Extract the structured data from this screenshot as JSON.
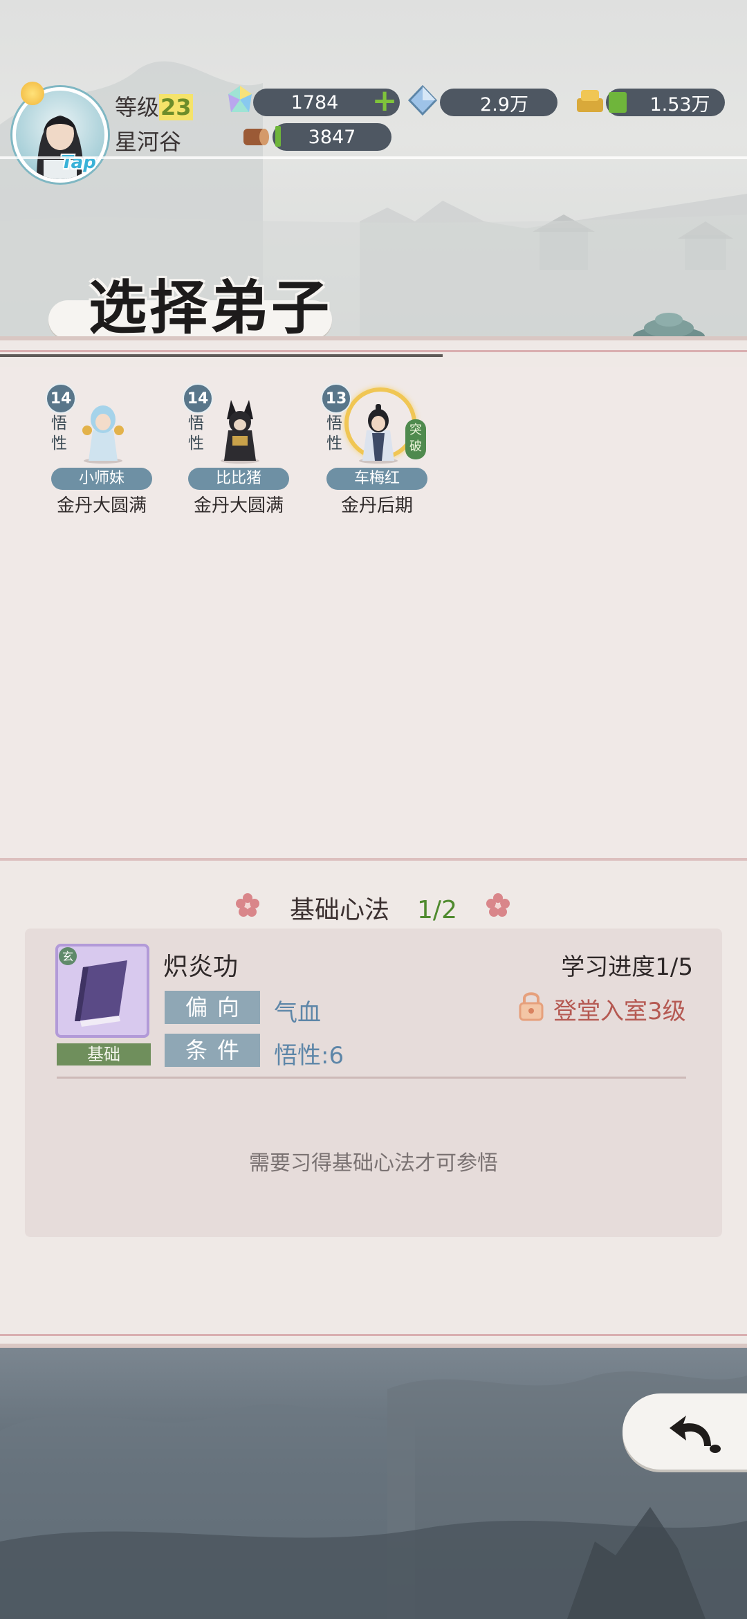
{
  "header": {
    "level_label": "等级",
    "level_value": "23",
    "sect_name": "星河谷",
    "avatar_badge": "Tap",
    "resources": {
      "spirit_stone": "1784",
      "crystal": "2.9万",
      "gold": "1.53万",
      "wood": "3847"
    },
    "add_symbol": "+"
  },
  "title": "选择弟子",
  "disciples": [
    {
      "level": "14",
      "attr": "悟性",
      "name": "小师妹",
      "realm": "金丹大圆满"
    },
    {
      "level": "14",
      "attr": "悟性",
      "name": "比比猪",
      "realm": "金丹大圆满"
    },
    {
      "level": "13",
      "attr": "悟性",
      "name": "车梅红",
      "realm": "金丹后期",
      "badge": "突破"
    }
  ],
  "skill_section": {
    "title": "基础心法",
    "count": "1/2",
    "skill": {
      "name": "炽炎功",
      "progress": "学习进度1/5",
      "book_grade": "玄",
      "book_type": "基础",
      "tag1_label": "偏向",
      "tag1_value": "气血",
      "tag2_label": "条件",
      "tag2_value": "悟性:6",
      "requirement": "登堂入室3级"
    },
    "hint": "需要习得基础心法才可参悟"
  },
  "colors": {
    "panel_bg": "#efe9e6",
    "accent_green": "#4f8a2e",
    "accent_red": "#b55952",
    "tag_blue": "#8fa7b5",
    "bottom_bg": "#5f6b75"
  }
}
